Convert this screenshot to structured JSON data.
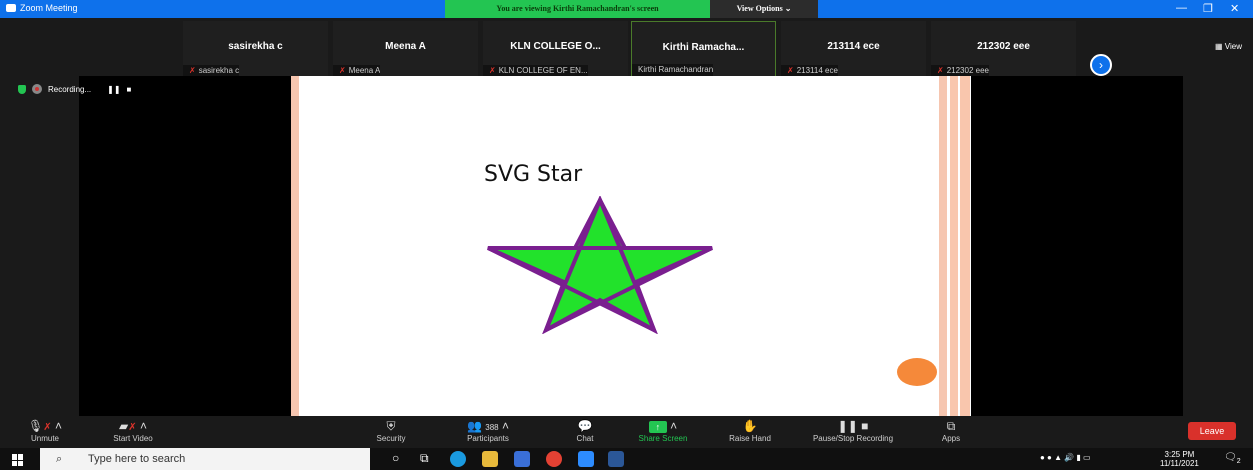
{
  "window": {
    "title": "Zoom Meeting",
    "viewing_banner": "You are viewing Kirthi Ramachandran's screen",
    "view_options": "View Options ⌄",
    "minimize": "—",
    "restore": "❐",
    "close": "✕"
  },
  "participants": [
    {
      "name": "sasirekha c",
      "sub": "sasirekha c",
      "muted": true
    },
    {
      "name": "Meena A",
      "sub": "Meena A",
      "muted": true
    },
    {
      "name": "KLN COLLEGE O...",
      "sub": "KLN COLLEGE OF EN...",
      "muted": true
    },
    {
      "name": "Kirthi  Ramacha...",
      "sub": "Kirthi Ramachandran",
      "muted": false
    },
    {
      "name": "213114 ece",
      "sub": "213114 ece",
      "muted": true
    },
    {
      "name": "212302 eee",
      "sub": "212302 eee",
      "muted": true
    }
  ],
  "strip": {
    "next_glyph": "›",
    "view_label": "▦ View"
  },
  "recording": {
    "label": "Recording...",
    "pause": "❚❚",
    "stop": "■"
  },
  "shared": {
    "slide_title": "SVG Star",
    "star_fill": "#22e22b",
    "star_stroke": "#7a1f8f",
    "dot_color": "#f5893a"
  },
  "toolbar": {
    "unmute": "Unmute",
    "start_video": "Start Video",
    "security": "Security",
    "participants": "Participants",
    "participants_count": "388",
    "chat": "Chat",
    "share_screen": "Share Screen",
    "raise_hand": "Raise Hand",
    "pause_stop_recording": "Pause/Stop Recording",
    "apps": "Apps",
    "leave": "Leave"
  },
  "taskbar": {
    "search_placeholder": "Type here to search",
    "time": "3:25 PM",
    "date": "11/11/2021",
    "notification_count": "2"
  }
}
